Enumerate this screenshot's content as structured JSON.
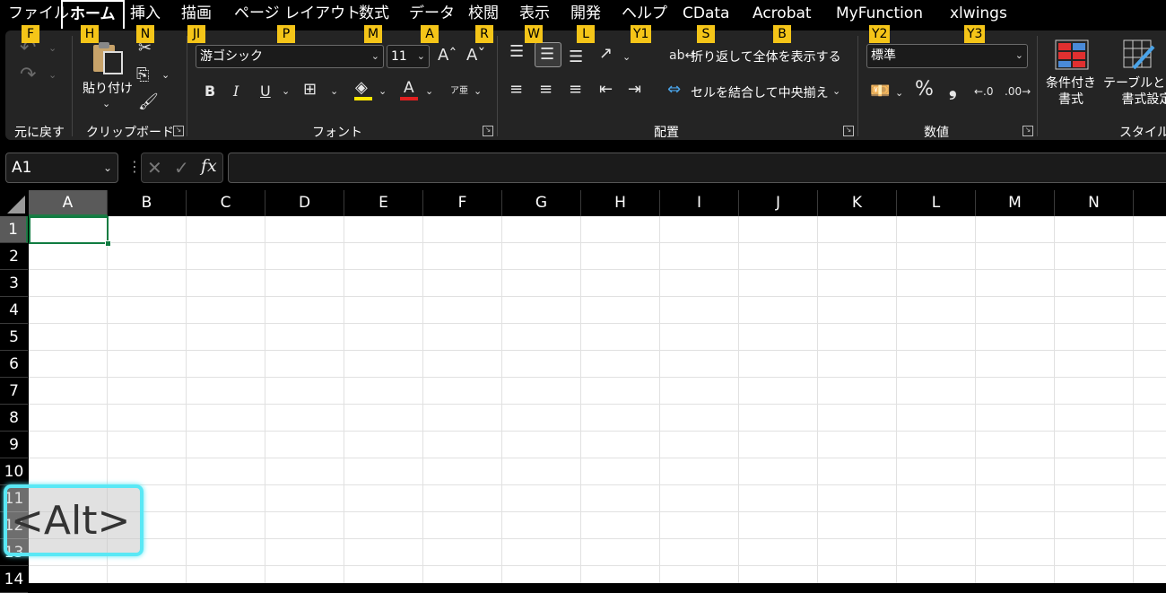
{
  "menu": {
    "items": [
      {
        "label": "ファイル",
        "keytip": "F"
      },
      {
        "label": "ホーム",
        "keytip": "H"
      },
      {
        "label": "挿入",
        "keytip": "N"
      },
      {
        "label": "描画",
        "keytip": "JI"
      },
      {
        "label": "ページ レイアウト",
        "keytip": "P"
      },
      {
        "label": "数式",
        "keytip": "M"
      },
      {
        "label": "データ",
        "keytip": "A"
      },
      {
        "label": "校閲",
        "keytip": "R"
      },
      {
        "label": "表示",
        "keytip": "W"
      },
      {
        "label": "開発",
        "keytip": "L"
      },
      {
        "label": "ヘルプ",
        "keytip": "Y1"
      },
      {
        "label": "CData",
        "keytip": "S"
      },
      {
        "label": "Acrobat",
        "keytip": "B"
      },
      {
        "label": "MyFunction",
        "keytip": "Y2"
      },
      {
        "label": "xlwings",
        "keytip": "Y3"
      }
    ]
  },
  "ribbon": {
    "undo_group": "元に戻す",
    "clipboard": {
      "paste_label": "貼り付け",
      "group": "クリップボード"
    },
    "font": {
      "family": "游ゴシック",
      "size": "11",
      "group": "フォント",
      "bold": "B",
      "italic": "I",
      "underline": "U",
      "color_letter": "A",
      "phonetic": "ア亜"
    },
    "alignment": {
      "wrap_text": "折り返して全体を表示する",
      "merge_center": "セルを結合して中央揃え",
      "group": "配置"
    },
    "number": {
      "format": "標準",
      "group": "数値",
      "percent": "%",
      "comma": "❟"
    },
    "styles": {
      "conditional": "条件付き\n書式",
      "table": "テーブルとして\n書式設定",
      "group": "スタイル"
    }
  },
  "formula_bar": {
    "name_box": "A1",
    "cancel": "✕",
    "enter": "✓",
    "fx": "fx",
    "value": ""
  },
  "grid": {
    "columns": [
      "A",
      "B",
      "C",
      "D",
      "E",
      "F",
      "G",
      "H",
      "I",
      "J",
      "K",
      "L",
      "M",
      "N"
    ],
    "rows": [
      "1",
      "2",
      "3",
      "4",
      "5",
      "6",
      "7",
      "8",
      "9",
      "10",
      "11",
      "12",
      "13",
      "14"
    ],
    "selected_cell": "A1"
  },
  "overlay": {
    "key_hint": "<Alt>"
  },
  "colors": {
    "accent_green": "#107c41",
    "keytip_yellow": "#f5c518",
    "overlay_cyan": "#59e8f5"
  }
}
